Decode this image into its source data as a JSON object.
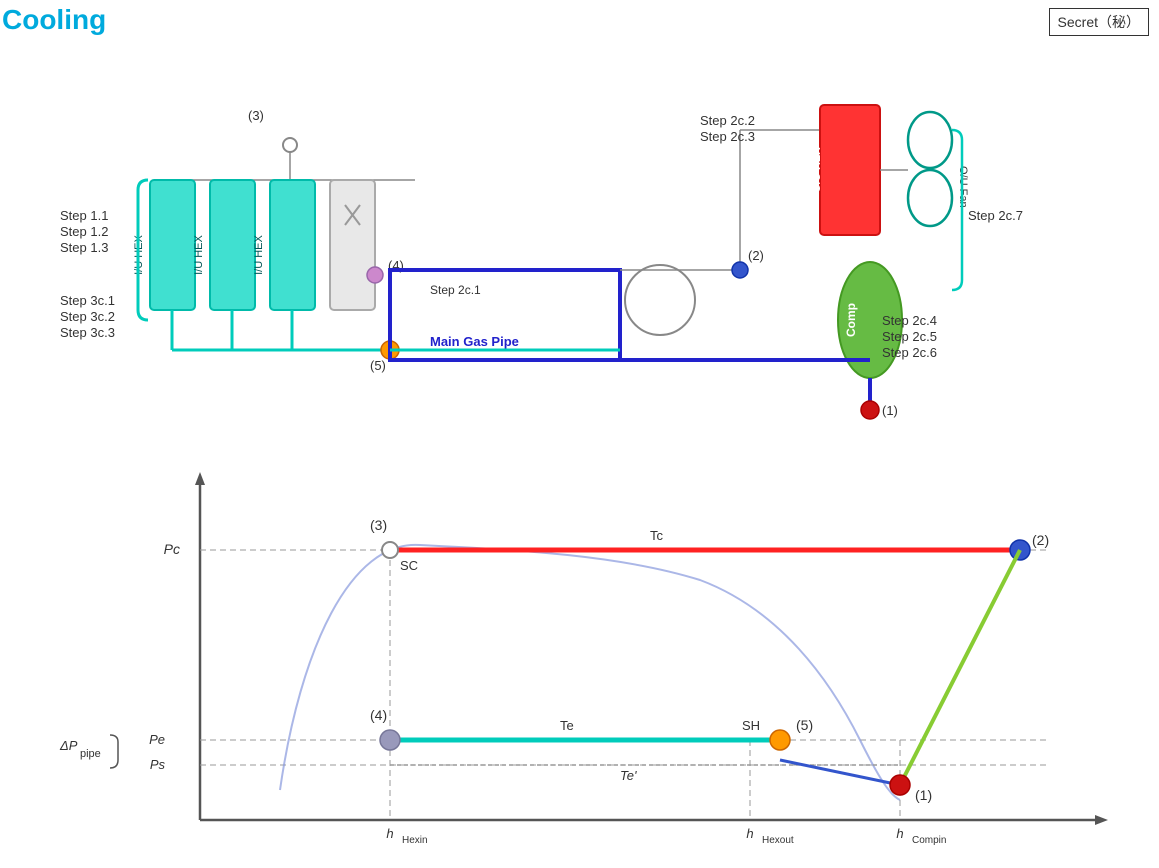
{
  "title": "Cooling",
  "secret_label": "Secret（秘）",
  "steps_left": {
    "step1": [
      "Step 1.1",
      "Step 1.2",
      "Step 1.3"
    ],
    "step3": [
      "Step 3c.1",
      "Step 3c.2",
      "Step 3c.3"
    ]
  },
  "steps_right": {
    "step2c_23": "Step 2c.2\nStep 2c.3",
    "step2c_7": "Step 2c.7",
    "step2c_456": [
      "Step 2c.4",
      "Step 2c.5",
      "Step 2c.6"
    ]
  },
  "labels": {
    "main_gas_pipe": "Main Gas Pipe",
    "iu_hex": "I/U HEX",
    "ou_hex": "O/U HEX",
    "comp": "Comp",
    "ou_fan": "O/U Fan",
    "step2c1": "Step 2c.1",
    "sc": "SC",
    "tc": "Tc",
    "te": "Te",
    "te_prime": "Te'",
    "sh": "SH",
    "pc": "Pc",
    "pe": "Pe",
    "ps": "Ps",
    "delta_p": "ΔPpipe",
    "h_hexin": "hHexin",
    "h_hexout": "hHexout",
    "h_compin": "hCompin"
  },
  "colors": {
    "title": "#00AADD",
    "iu_hex_fill": "#40E0D0",
    "ou_hex_fill": "#FF3333",
    "comp_fill": "#66BB44",
    "main_pipe": "#2222CC",
    "teal_pipe": "#00CCBB",
    "red_line": "#FF2222",
    "green_line": "#88CC33",
    "blue_dot_line": "#3355CC",
    "orange_dot": "#FF9900",
    "gray_dot": "#888888",
    "blue_dot": "#3355CC",
    "red_dot": "#CC1111"
  }
}
